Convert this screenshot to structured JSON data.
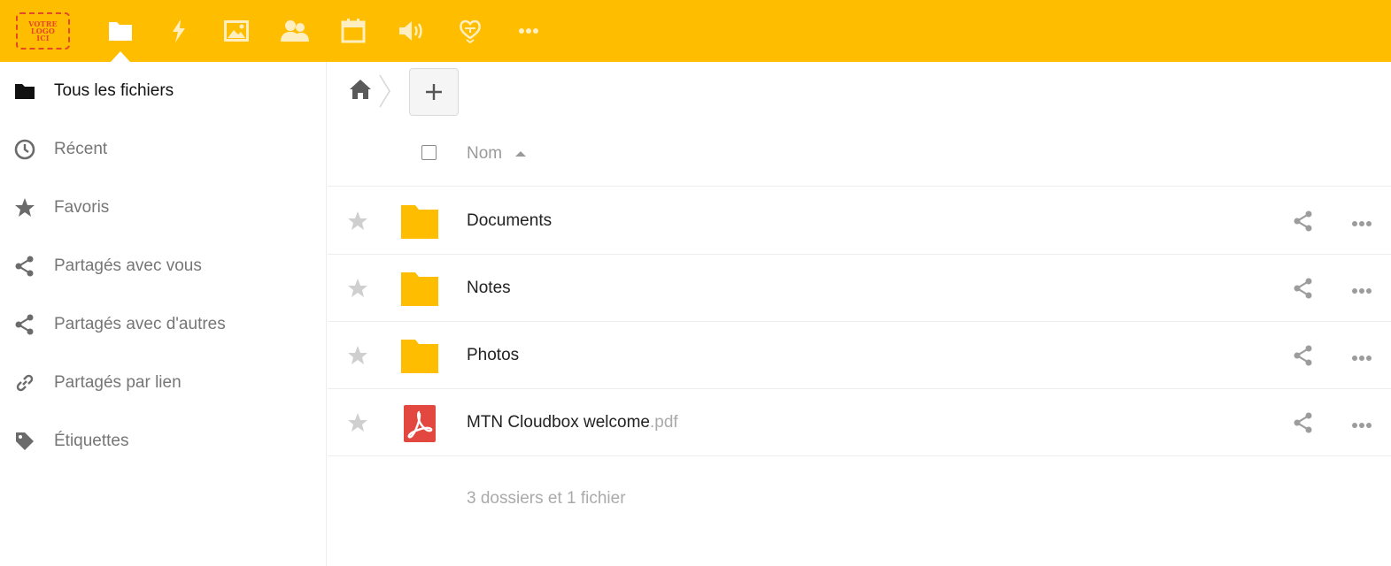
{
  "header": {
    "logo_lines": [
      "VOTRE",
      "LOGO",
      "ICI"
    ],
    "brand_color": "#ffbd00",
    "apps": [
      {
        "name": "files-icon",
        "active": true
      },
      {
        "name": "activity-icon"
      },
      {
        "name": "gallery-icon"
      },
      {
        "name": "contacts-icon"
      },
      {
        "name": "calendar-icon"
      },
      {
        "name": "audio-icon"
      },
      {
        "name": "heart-app-icon"
      },
      {
        "name": "more-apps-icon"
      }
    ]
  },
  "sidebar": {
    "items": [
      {
        "label": "Tous les fichiers",
        "icon": "folder-icon",
        "active": true
      },
      {
        "label": "Récent",
        "icon": "clock-icon"
      },
      {
        "label": "Favoris",
        "icon": "star-icon"
      },
      {
        "label": "Partagés avec vous",
        "icon": "share-icon"
      },
      {
        "label": "Partagés avec d'autres",
        "icon": "share-icon"
      },
      {
        "label": "Partagés par lien",
        "icon": "link-icon"
      },
      {
        "label": "Étiquettes",
        "icon": "tag-icon"
      }
    ]
  },
  "toolbar": {
    "home_icon": "home-icon",
    "add_label": "+"
  },
  "file_list": {
    "column_name": "Nom",
    "rows": [
      {
        "name": "Documents",
        "ext": "",
        "type": "folder"
      },
      {
        "name": "Notes",
        "ext": "",
        "type": "folder"
      },
      {
        "name": "Photos",
        "ext": "",
        "type": "folder"
      },
      {
        "name": "MTN Cloudbox welcome",
        "ext": ".pdf",
        "type": "pdf"
      }
    ],
    "summary": "3 dossiers et 1 fichier"
  },
  "colors": {
    "folder": "#ffbd00",
    "pdf": "#e2483f",
    "muted_text": "#767676"
  }
}
